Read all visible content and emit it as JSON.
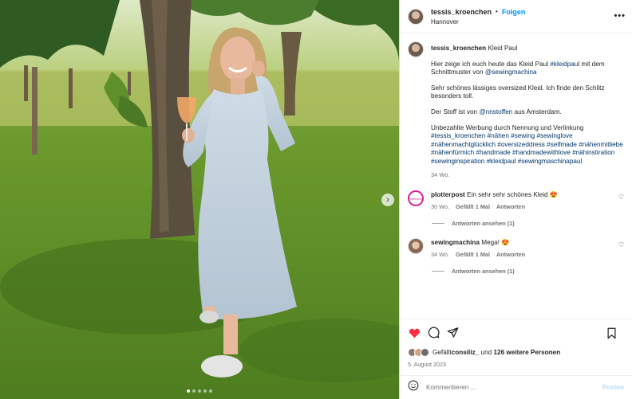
{
  "post": {
    "username": "tessis_kroenchen",
    "follow_label": "Folgen",
    "separator": "•",
    "location": "Hannover",
    "more_icon": "more-horizontal-icon"
  },
  "caption": {
    "username": "tessis_kroenchen",
    "title": "Kleid Paul",
    "p1_a": "Hier zeige ich euch heute das Kleid Paul ",
    "p1_tag": "#kleidpaul",
    "p1_b": " mit dem Schnittmuster von ",
    "p1_mention": "@sewingmachina",
    "p2": "Sehr schönes lässiges oversized Kleid. Ich finde den Schlitz besonders toll.",
    "p3_a": "Der Stoff ist von ",
    "p3_mention": "@nnstoffen",
    "p3_b": " aus Amsterdam.",
    "p4": "Unbezahlte Werbung durch Nennung und Verlinkung",
    "hashtags": "#tessis_kroenchen #nähen #sewing #sewinglove #nähenmachtglücklich #oversizeddress #selfmade #nähenmitliebe #nähenfürmich #handmade #handmadewithlove #nähinstiration #sewinginspiration #kleidpaul #sewingmaschinapaul",
    "age": "34 Wo."
  },
  "comments": [
    {
      "username": "plotterpost",
      "avatar_text": "Plotterpost",
      "text": "Ein sehr sehr schönes Kleid 😍",
      "age": "30 Wo.",
      "likes": "Gefällt 1 Mal",
      "reply_label": "Antworten",
      "view_replies": "Antworten ansehen (1)"
    },
    {
      "username": "sewingmachina",
      "text": "Mega! 😍",
      "age": "34 Wo.",
      "likes": "Gefällt 1 Mal",
      "reply_label": "Antworten",
      "view_replies": "Antworten ansehen (1)"
    }
  ],
  "likes": {
    "prefix": "Gefällt ",
    "user": "consiliz_",
    "middle": " und ",
    "others": "126 weitere Personen"
  },
  "date": "5. August 2023",
  "add_comment": {
    "placeholder": "Kommentieren ...",
    "post_label": "Posten",
    "emoji_icon": "smiley-icon"
  },
  "colors": {
    "accent": "#0095f6",
    "like": "#ff3040",
    "hashtag": "#00376b"
  }
}
